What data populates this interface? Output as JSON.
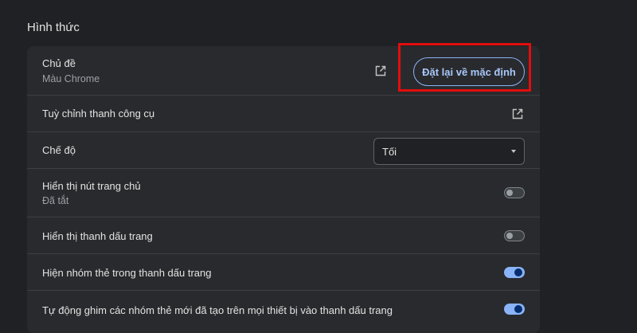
{
  "section": {
    "title": "Hình thức"
  },
  "theme": {
    "label": "Chủ đề",
    "value": "Màu Chrome",
    "open_icon": "open-in-new-icon",
    "reset_label": "Đặt lại về mặc định",
    "highlight_color": "#e20d0d"
  },
  "toolbar": {
    "label": "Tuỳ chỉnh thanh công cụ",
    "open_icon": "open-in-new-icon"
  },
  "mode": {
    "label": "Chế độ",
    "selected": "Tối"
  },
  "home_button": {
    "label": "Hiển thị nút trang chủ",
    "status": "Đã tắt",
    "enabled": false
  },
  "bookmarks_bar": {
    "label": "Hiển thị thanh dấu trang",
    "enabled": false
  },
  "tab_groups": {
    "label": "Hiện nhóm thẻ trong thanh dấu trang",
    "enabled": true
  },
  "auto_pin": {
    "label": "Tự động ghim các nhóm thẻ mới đã tạo trên mọi thiết bị vào thanh dấu trang",
    "enabled": true
  },
  "colors": {
    "background": "#202124",
    "card": "#292a2d",
    "accent": "#8ab4f8",
    "toggle_on_knob": "#062e6f"
  }
}
